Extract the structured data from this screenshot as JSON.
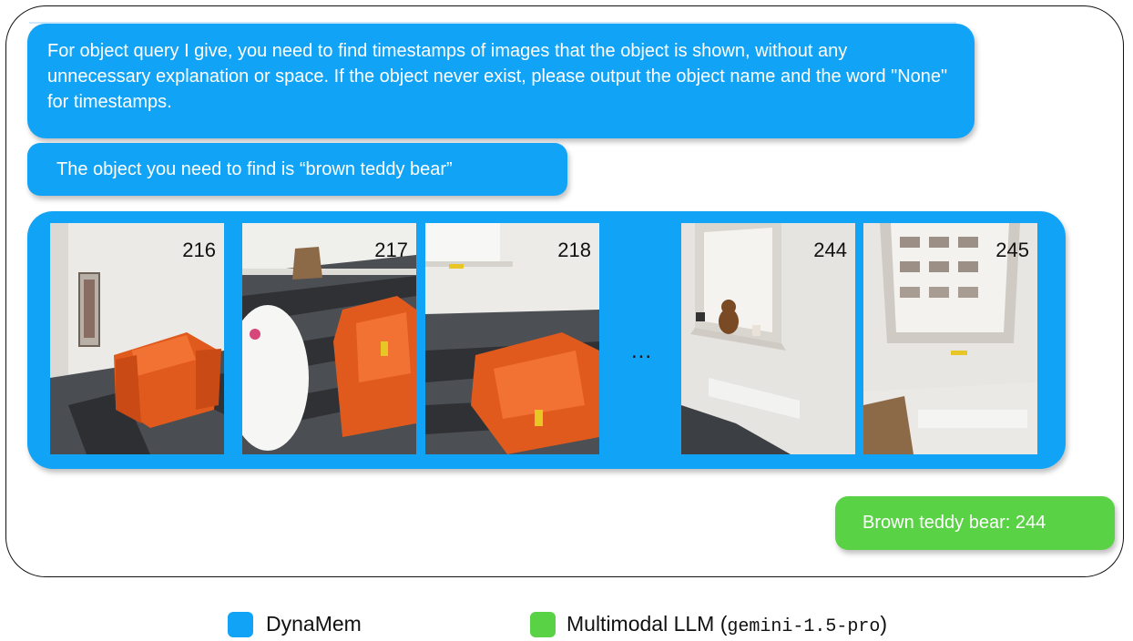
{
  "prompt": {
    "text": "For object query I give, you need to find timestamps of images that the object is shown, without any unnecessary explanation or space. If the object never exist, please output the object name and the word \"None\" for timestamps."
  },
  "query": {
    "text": "The object you need to find is “brown teddy bear”"
  },
  "frames": [
    {
      "timestamp": "216"
    },
    {
      "timestamp": "217"
    },
    {
      "timestamp": "218"
    },
    {
      "timestamp": "244"
    },
    {
      "timestamp": "245"
    }
  ],
  "ellipsis": "...",
  "answer": {
    "text": "Brown teddy bear: 244"
  },
  "legend": {
    "dynamem": "DynaMem",
    "llm_prefix": "Multimodal LLM (",
    "llm_model": "gemini-1.5-pro",
    "llm_suffix": ")"
  },
  "colors": {
    "dynamem": "#11a3f6",
    "llm": "#5ad246"
  }
}
